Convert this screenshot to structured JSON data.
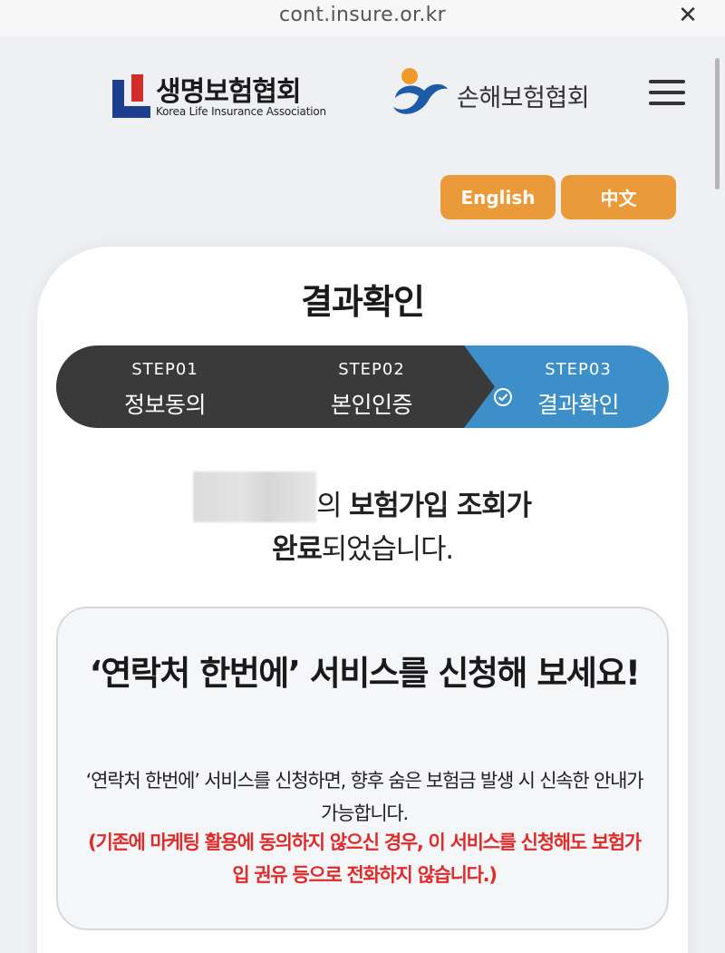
{
  "browser": {
    "url": "cont.insure.or.kr",
    "close_icon": "close-icon"
  },
  "header": {
    "klia_name": "생명보험협회",
    "klia_en": "Korea Life Insurance Association",
    "gia_name": "손해보험협회",
    "menu_icon": "hamburger-icon"
  },
  "languages": {
    "english": "English",
    "chinese": "中文"
  },
  "page": {
    "title": "결과확인"
  },
  "steps": [
    {
      "num": "STEP01",
      "label": "정보동의"
    },
    {
      "num": "STEP02",
      "label": "본인인증"
    },
    {
      "num": "STEP03",
      "label": "결과확인"
    }
  ],
  "result": {
    "suffix_normal": "의 ",
    "suffix_bold": "보험가입 조회가",
    "line2_bold": "완료",
    "line2_normal": "되었습니다."
  },
  "promo": {
    "title": "‘연락처 한번에’ 서비스를 신청해 보세요!",
    "description": "‘연락처 한번에’ 서비스를 신청하면, 향후 숨은 보험금 발생 시 신속한 안내가 가능합니다.",
    "warning": "(기존에 마케팅 활용에 동의하지 않으신 경우, 이 서비스를 신청해도 보험가입 권유 등으로 전화하지 않습니다.)"
  },
  "colors": {
    "accent_orange": "#eb9a39",
    "step_active": "#3d8fca",
    "step_inactive": "#3a3a3a",
    "warning_red": "#e02b2b"
  }
}
